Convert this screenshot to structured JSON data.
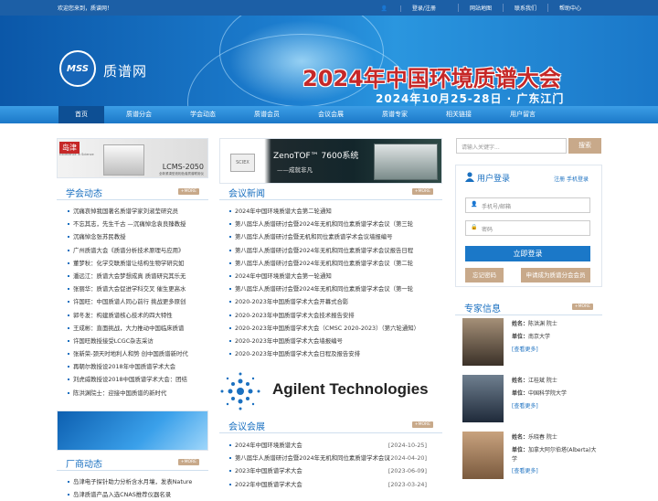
{
  "topbar": {
    "welcome": "欢迎您来到，质谱网！",
    "links": [
      "登录/注册",
      "网站地图",
      "联系我们",
      "帮助中心"
    ]
  },
  "banner": {
    "logo": "MSS",
    "logo_text": "质谱网",
    "title": "2024年中国环境质谱大会",
    "subtitle": "2024年10月25-28日 · 广东江门"
  },
  "nav": [
    "首页",
    "质谱分会",
    "学会动态",
    "质谱会员",
    "会议会展",
    "质谱专家",
    "相关链接",
    "用户留言"
  ],
  "ads": {
    "shimadzu": "岛津",
    "shimadzu_sub": "Excellence in Science",
    "lcms": "LCMS-2050",
    "lcms_sub": "全新紧凑型液相色谱质谱联用仪",
    "sciex": "SCIEX",
    "zenotof": "ZenoTOF™ 7600系统",
    "zenotof_sub": "——成就非凡",
    "agilent": "Agilent Technologies"
  },
  "society_news": {
    "title": "学会动态",
    "more": "+MORE",
    "items": [
      "沉痛哀悼我国著名质谱学家刘淑莹研究员",
      "不忘其志，先生千古 —沉痛悼念袁良臻教授",
      "沉痛悼念张苏民教授",
      "广州质谱大会《质谱分析技术原理与应用》",
      "董梦秋：化学交联质谱让结构生物学研究如",
      "潘远江：质谱大会梦想成真 质谱研究其乐无",
      "张丽华：质谱大会促进学科交叉 催生更高水",
      "许国旺：中国质谱人同心前行 挑战更多原创",
      "郭冬发：构建质谱核心技术的四大特性",
      "王成彬：直面挑战，大力推动中国临床质谱",
      "许国旺教授接受LCGC杂志采访",
      "张新荣-颈天时地利人和势 创中国质谱新时代",
      "再朝尔教授设2018年中国质谱学术大会",
      "刘虎威教授设2018中国质谱学术大会：团结",
      "陈洪渊院士：迎接中国质谱的新时代"
    ]
  },
  "meeting_news": {
    "title": "会议新闻",
    "more": "+MORE",
    "items": [
      "2024年中国环境质谱大会第二轮通知",
      "第八届华人质谱研讨会暨2024年无机和同位素质谱学术会议（第三轮",
      "第八届华人质谱研讨会暨无机和同位素质谱学术会议墙报编号",
      "第八届华人质谱研讨会暨2024年无机和同位素质谱学术会议报告日程",
      "第八届华人质谱研讨会暨2024年无机和同位素质谱学术会议（第二轮",
      "2024年中国环境质谱大会第一轮通知",
      "第八届华人质谱研讨会暨2024年无机和同位素质谱学术会议（第一轮",
      "2020-2023年中国质谱学术大会开幕式合影",
      "2020-2023年中国质谱学术大会技术报告安排",
      "2020-2023年中国质谱学术大会（CMSC 2020-2023）（第六轮通知）",
      "2020-2023年中国质谱学术大会墙报编号",
      "2020-2023年中国质谱学术大会日程及报告安排"
    ]
  },
  "expo": {
    "title": "会议会展",
    "more": "+MORE",
    "items": [
      {
        "t": "2024年中国环境质谱大会",
        "d": "[2024-10-25]"
      },
      {
        "t": "第八届华人质谱研讨会暨2024年无机和同位素质谱学术会议",
        "d": "[2024-04-20]"
      },
      {
        "t": "2023年中国质谱学术大会",
        "d": "[2023-06-09]"
      },
      {
        "t": "2022年中国质谱学术大会",
        "d": "[2023-03-24]"
      }
    ]
  },
  "vendor_news": {
    "title": "厂商动态",
    "more": "+MORE",
    "items": [
      "岛津电子探针助力分析含水月壤，发表Nature",
      "岛津质谱产品入选CNAS推荐仪器名录"
    ]
  },
  "search": {
    "placeholder": "请输入关键字...",
    "button": "搜索"
  },
  "login": {
    "title": "用户登录",
    "links": "注册  手机登录",
    "phone": "手机号/邮箱",
    "password": "密码",
    "submit": "立即登录",
    "forgot": "忘记密码",
    "apply": "申请成为质谱分会会员"
  },
  "experts": {
    "title": "专家信息",
    "more": "+MORE",
    "people": [
      {
        "name_label": "姓名：",
        "name": "陈洪渊 院士",
        "org_label": "单位：",
        "org": "南京大学",
        "more": "[查看更多]"
      },
      {
        "name_label": "姓名：",
        "name": "江桂斌 院士",
        "org_label": "单位：",
        "org": "中国科学院大学",
        "more": "[查看更多]"
      },
      {
        "name_label": "姓名：",
        "name": "乐晓春 院士",
        "org_label": "单位：",
        "org": "加拿大阿尔伯塔(Alberta)大学",
        "more": "[查看更多]"
      }
    ]
  }
}
